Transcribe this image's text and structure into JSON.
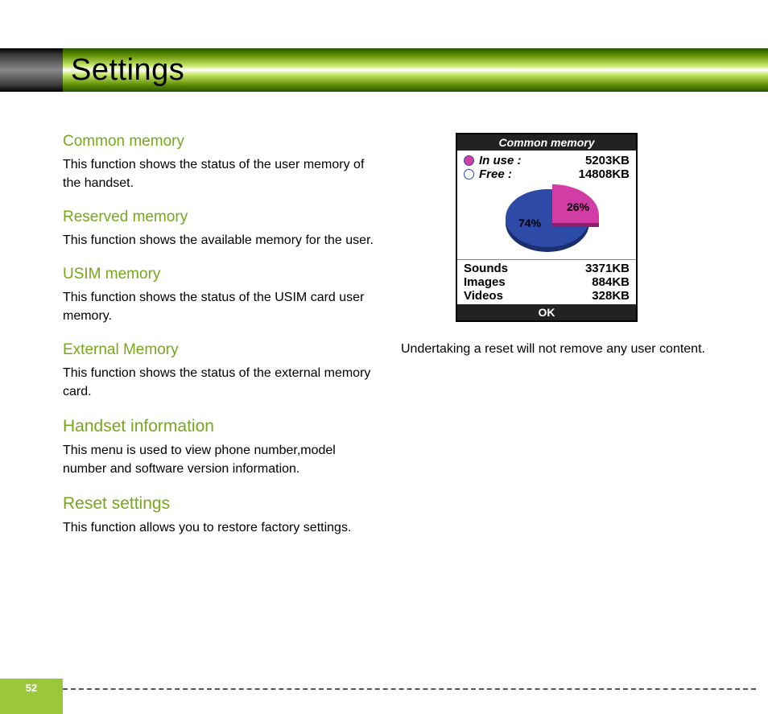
{
  "page_title": "Settings",
  "page_number": "52",
  "left": {
    "s1_h": "Common memory",
    "s1_p": "This function shows the status of the user memory of the handset.",
    "s2_h": "Reserved memory",
    "s2_p": "This function shows the available memory for the user.",
    "s3_h": "USIM memory",
    "s3_p": "This function shows the status of the USIM card user memory.",
    "s4_h": "External Memory",
    "s4_p": "This function shows the status of the external memory card.",
    "s5_h": "Handset information",
    "s5_p": "This menu is used to view phone number,model number and software version information.",
    "s6_h": "Reset settings",
    "s6_p": "This function allows you to restore factory settings."
  },
  "right": {
    "caption": "Undertaking a reset will not remove any user content."
  },
  "phone": {
    "title": "Common memory",
    "in_use_label": "In use :",
    "in_use_value": "5203KB",
    "free_label": "Free :",
    "free_value": "14808KB",
    "pct_use": "26%",
    "pct_free": "74%",
    "rows": [
      {
        "label": "Sounds",
        "value": "3371KB"
      },
      {
        "label": "Images",
        "value": "884KB"
      },
      {
        "label": "Videos",
        "value": "328KB"
      }
    ],
    "ok": "OK"
  },
  "chart_data": {
    "type": "pie",
    "title": "Common memory",
    "series": [
      {
        "name": "In use",
        "value": 5203,
        "percent": 26,
        "unit": "KB",
        "color": "#d23ca5"
      },
      {
        "name": "Free",
        "value": 14808,
        "percent": 74,
        "unit": "KB",
        "color": "#2d4aa7"
      }
    ],
    "breakdown": [
      {
        "name": "Sounds",
        "value": 3371,
        "unit": "KB"
      },
      {
        "name": "Images",
        "value": 884,
        "unit": "KB"
      },
      {
        "name": "Videos",
        "value": 328,
        "unit": "KB"
      }
    ]
  }
}
